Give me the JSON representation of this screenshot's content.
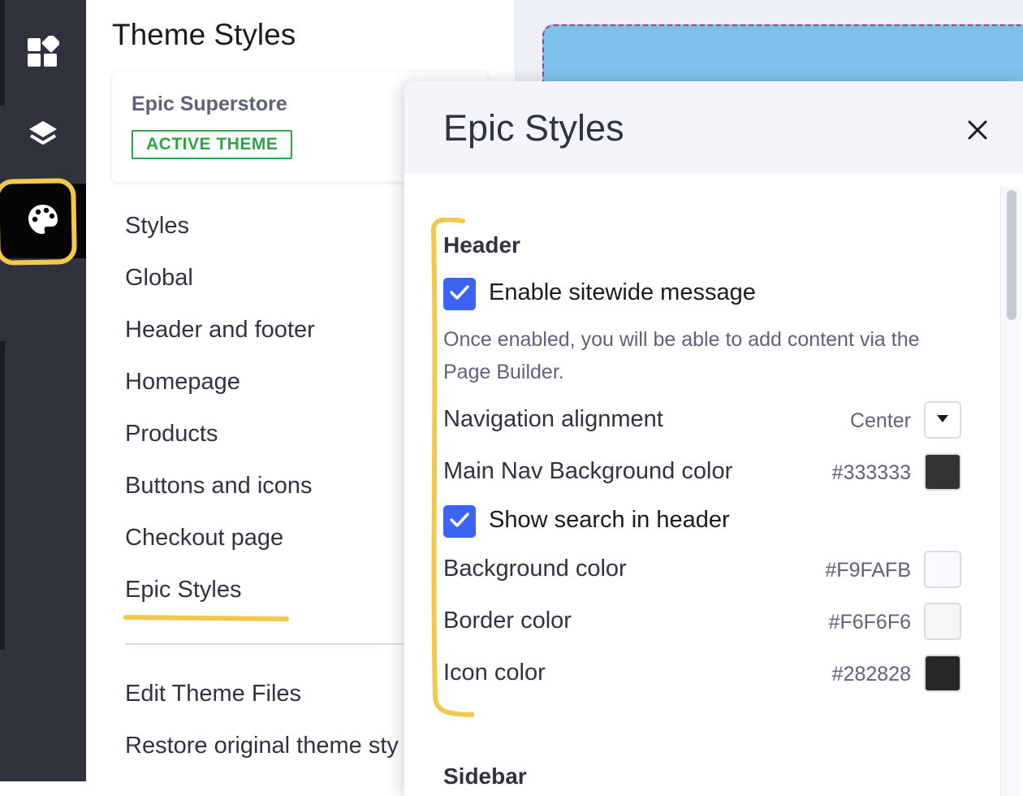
{
  "panel": {
    "title": "Theme Styles",
    "theme_card": {
      "name": "Epic Superstore",
      "badge": "ACTIVE THEME"
    },
    "nav_items": [
      "Styles",
      "Global",
      "Header and footer",
      "Homepage",
      "Products",
      "Buttons and icons",
      "Checkout page",
      "Epic Styles"
    ],
    "footer_items": [
      "Edit Theme Files",
      "Restore original theme sty"
    ]
  },
  "rail": {
    "icons": [
      "widgets-icon",
      "layers-icon",
      "palette-icon"
    ],
    "active": "palette-icon"
  },
  "drawer": {
    "title": "Epic Styles",
    "close_icon": "close-icon",
    "sections": [
      {
        "title": "Header",
        "enable_message": {
          "label": "Enable sitewide message",
          "checked": true
        },
        "help_text": "Once enabled, you will be able to add content via the Page Builder.",
        "nav_alignment": {
          "label": "Navigation alignment",
          "value": "Center"
        },
        "main_nav_bg": {
          "label": "Main Nav Background color",
          "value": "#333333"
        },
        "show_search": {
          "label": "Show search in header",
          "checked": true
        },
        "background": {
          "label": "Background color",
          "value": "#F9FAFB"
        },
        "border": {
          "label": "Border color",
          "value": "#F6F6F6"
        },
        "icon": {
          "label": "Icon color",
          "value": "#282828"
        }
      },
      {
        "title": "Sidebar"
      }
    ]
  },
  "colors": {
    "rail_bg": "#30323e",
    "accent_blue": "#3c64f4",
    "active_green": "#2aa743",
    "highlight_yellow": "#f2c94c",
    "preview_blue": "#7dc2ea"
  }
}
